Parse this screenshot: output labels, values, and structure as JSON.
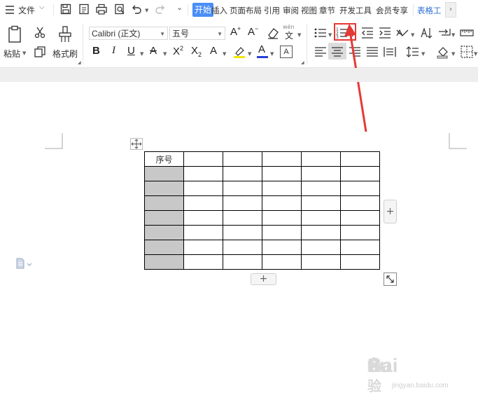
{
  "menubar": {
    "file_label": "文件",
    "tabs": [
      {
        "label": "开始",
        "active": true
      },
      {
        "label": "插入"
      },
      {
        "label": "页面布局"
      },
      {
        "label": "引用"
      },
      {
        "label": "审阅"
      },
      {
        "label": "视图"
      },
      {
        "label": "章节"
      },
      {
        "label": "开发工具"
      },
      {
        "label": "会员专享"
      },
      {
        "label": "表格工"
      }
    ]
  },
  "ribbon": {
    "paste_label": "粘贴",
    "format_painter_label": "格式刷",
    "font_name": "Calibri (正文)",
    "font_size": "五号",
    "phonetic_label": "wén",
    "bold": "B",
    "italic": "I",
    "underline": "U"
  },
  "highlight_color": "#e53935",
  "table": {
    "header_cell": "序号",
    "columns": 6,
    "rows": 8,
    "shade_color": "#c8c8c8"
  },
  "watermark": {
    "brand": "Bai",
    "brand2": "du",
    "cn": "经验",
    "url": "jingyan.baidu.com"
  }
}
